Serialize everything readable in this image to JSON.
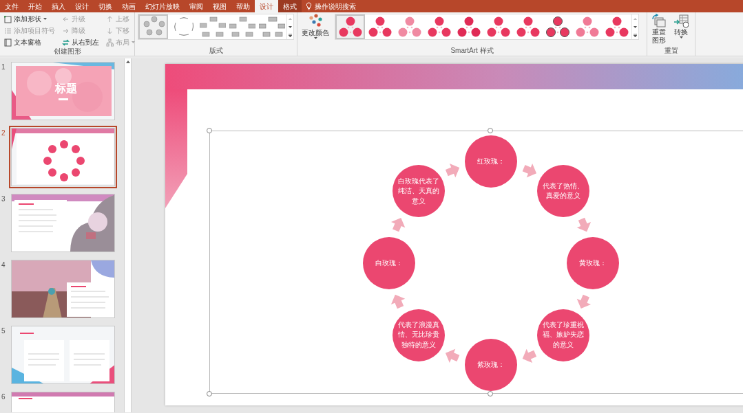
{
  "ribbon_tabs": [
    {
      "label": "文件",
      "selected": false,
      "contextual": false
    },
    {
      "label": "开始",
      "selected": false,
      "contextual": false
    },
    {
      "label": "插入",
      "selected": false,
      "contextual": false
    },
    {
      "label": "设计",
      "selected": false,
      "contextual": false
    },
    {
      "label": "切换",
      "selected": false,
      "contextual": false
    },
    {
      "label": "动画",
      "selected": false,
      "contextual": false
    },
    {
      "label": "幻灯片放映",
      "selected": false,
      "contextual": false
    },
    {
      "label": "审阅",
      "selected": false,
      "contextual": false
    },
    {
      "label": "视图",
      "selected": false,
      "contextual": false
    },
    {
      "label": "帮助",
      "selected": false,
      "contextual": false
    },
    {
      "label": "设计",
      "selected": true,
      "contextual": true
    },
    {
      "label": "格式",
      "selected": false,
      "contextual": true
    }
  ],
  "tell_me": {
    "placeholder": "操作说明搜索"
  },
  "create_graphic": {
    "label": "创建图形",
    "commands": [
      {
        "label": "添加形状",
        "disabled": false,
        "dropdown": true
      },
      {
        "label": "添加项目符号",
        "disabled": true,
        "dropdown": false
      },
      {
        "label": "文本窗格",
        "disabled": false,
        "dropdown": false
      },
      {
        "label": "升级",
        "disabled": true,
        "dropdown": false
      },
      {
        "label": "降级",
        "disabled": true,
        "dropdown": false
      },
      {
        "label": "从右到左",
        "disabled": false,
        "dropdown": false
      },
      {
        "label": "上移",
        "disabled": true,
        "dropdown": false
      },
      {
        "label": "下移",
        "disabled": true,
        "dropdown": false
      },
      {
        "label": "布局",
        "disabled": true,
        "dropdown": true
      }
    ]
  },
  "layouts": {
    "label": "版式",
    "items": [
      {
        "selected": true
      },
      {
        "selected": false
      },
      {
        "selected": false
      },
      {
        "selected": false
      },
      {
        "selected": false
      }
    ]
  },
  "change_colors": {
    "label": "更改颜色"
  },
  "smartart_styles": {
    "label": "SmartArt 样式",
    "items": [
      {
        "selected": true
      },
      {
        "selected": false
      },
      {
        "selected": false
      },
      {
        "selected": false
      },
      {
        "selected": false
      },
      {
        "selected": false
      },
      {
        "selected": false
      },
      {
        "selected": false
      },
      {
        "selected": false
      },
      {
        "selected": false
      }
    ]
  },
  "reset": {
    "label": "重置",
    "commands": [
      {
        "label": "重置图形",
        "dropdown": false
      },
      {
        "label": "转换",
        "dropdown": true
      }
    ]
  },
  "slides": [
    {
      "number": "1",
      "selected": false,
      "kind": "title",
      "title": "标题"
    },
    {
      "number": "2",
      "selected": true,
      "kind": "cycle"
    },
    {
      "number": "3",
      "selected": false,
      "kind": "text-picture"
    },
    {
      "number": "4",
      "selected": false,
      "kind": "picture-text"
    },
    {
      "number": "5",
      "selected": false,
      "kind": "two-column"
    },
    {
      "number": "6",
      "selected": false,
      "kind": "header"
    }
  ],
  "smartart": {
    "nodes": [
      {
        "text": "红玫瑰："
      },
      {
        "text": "代表了热情、真爱的意义"
      },
      {
        "text": "黄玫瑰："
      },
      {
        "text": "代表了珍重祝福、嫉妒失恋的意义"
      },
      {
        "text": "紫玫瑰："
      },
      {
        "text": "代表了浪漫真情、无比珍贵独特的意义"
      },
      {
        "text": "白玫瑰："
      },
      {
        "text": "白玫瑰代表了纯洁、天真的意义"
      }
    ]
  }
}
